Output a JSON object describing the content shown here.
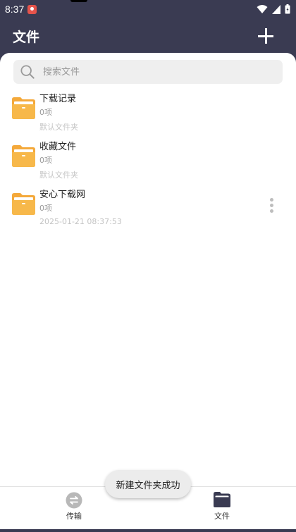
{
  "status_bar": {
    "time": "8:37"
  },
  "header": {
    "title": "文件"
  },
  "search": {
    "placeholder": "搜索文件"
  },
  "folders": [
    {
      "name": "下载记录",
      "count": "0项",
      "sub": "默认文件夹",
      "has_more": false
    },
    {
      "name": "收藏文件",
      "count": "0项",
      "sub": "默认文件夹",
      "has_more": false
    },
    {
      "name": "安心下载网",
      "count": "0项",
      "sub": "2025-01-21 08:37:53",
      "has_more": true
    }
  ],
  "toast": {
    "text": "新建文件夹成功"
  },
  "bottom_nav": {
    "items": [
      {
        "label": "传输",
        "icon": "transfer-icon",
        "active": false
      },
      {
        "label": "文件",
        "icon": "folder-icon",
        "active": true
      }
    ]
  },
  "colors": {
    "header_bg": "#3a3b52",
    "folder": "#f7b84a",
    "surface": "#ffffff"
  }
}
